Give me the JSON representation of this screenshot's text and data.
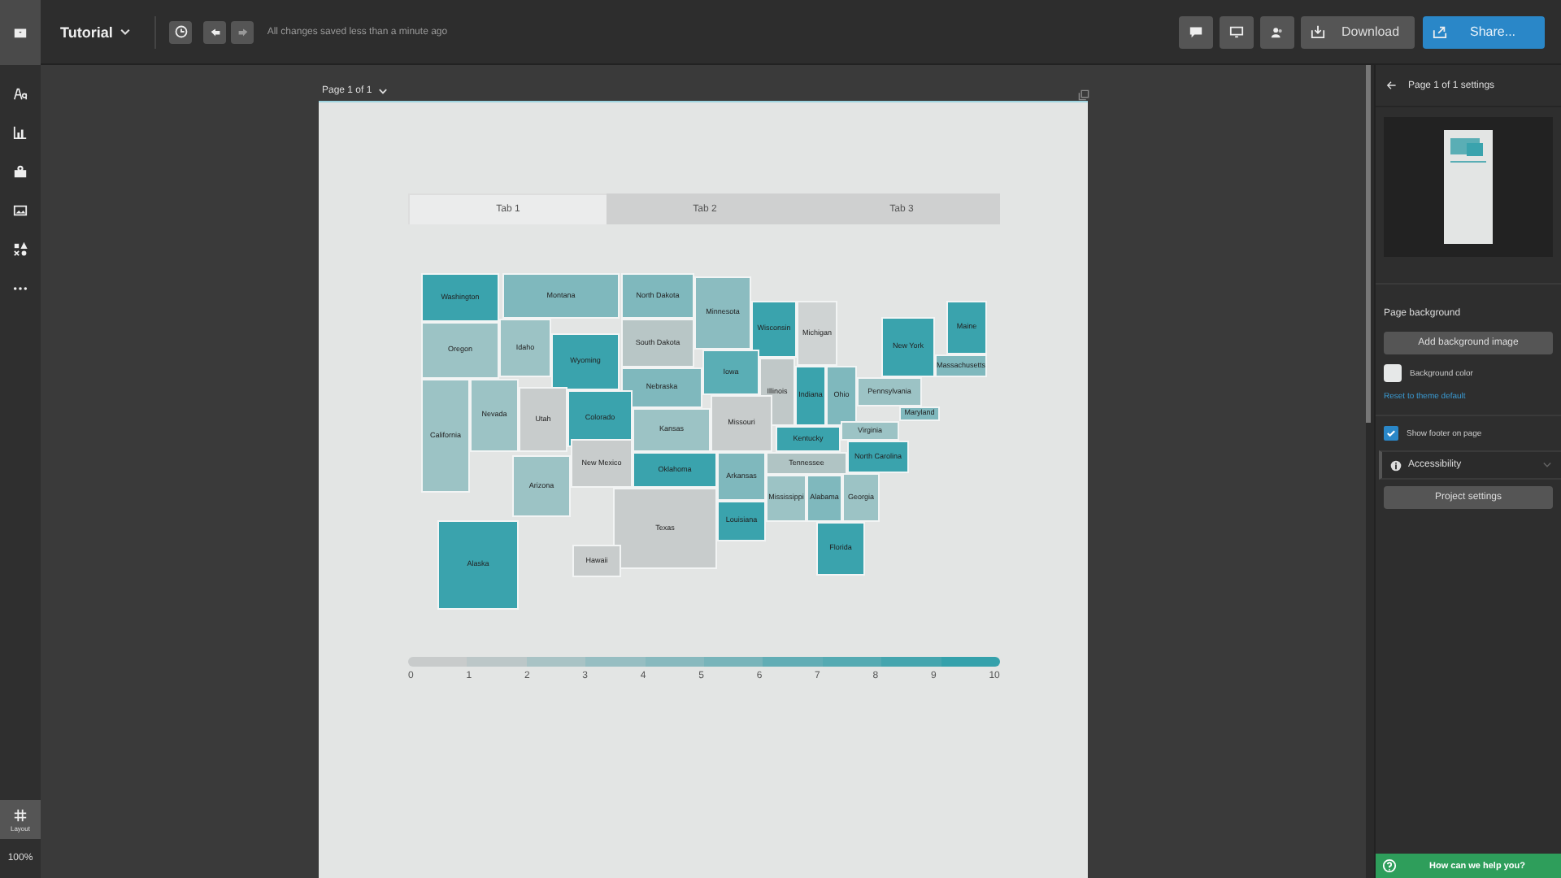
{
  "app_bar": {
    "title": "Tutorial",
    "status": "All changes saved less than a minute ago",
    "download": "Download",
    "share": "Share..."
  },
  "sidebar": {
    "layout": "Layout",
    "zoom": "100%"
  },
  "page": {
    "label": "Page 1 of 1",
    "tabs": [
      {
        "label": "Tab 1",
        "selected": true
      },
      {
        "label": "Tab 2",
        "selected": false
      },
      {
        "label": "Tab 3",
        "selected": false
      }
    ],
    "states": [
      {
        "name": "Washington",
        "color": "#3aa3ad"
      },
      {
        "name": "Montana",
        "color": "#7fb8bd"
      },
      {
        "name": "North Dakota",
        "color": "#7fb8bd"
      },
      {
        "name": "Minnesota",
        "color": "#8bbcc0"
      },
      {
        "name": "Wisconsin",
        "color": "#3aa3ad"
      },
      {
        "name": "Michigan",
        "color": "#cfd3d3"
      },
      {
        "name": "Maine",
        "color": "#3aa3ad"
      },
      {
        "name": "Idaho",
        "color": "#9cc3c5"
      },
      {
        "name": "South Dakota",
        "color": "#b8c6c6"
      },
      {
        "name": "New York",
        "color": "#3aa3ad"
      },
      {
        "name": "Oregon",
        "color": "#9cc3c5"
      },
      {
        "name": "Wyoming",
        "color": "#3aa3ad"
      },
      {
        "name": "Iowa",
        "color": "#5aaeb5"
      },
      {
        "name": "Massachusetts",
        "color": "#7fb8bd"
      },
      {
        "name": "Illinois",
        "color": "#c0c8c8"
      },
      {
        "name": "Indiana",
        "color": "#3aa3ad"
      },
      {
        "name": "Ohio",
        "color": "#7fb8bd"
      },
      {
        "name": "Nebraska",
        "color": "#7fb8bd"
      },
      {
        "name": "Pennsylvania",
        "color": "#9cc3c5"
      },
      {
        "name": "California",
        "color": "#9cc3c5"
      },
      {
        "name": "Nevada",
        "color": "#9cc3c5"
      },
      {
        "name": "Utah",
        "color": "#c8cccc"
      },
      {
        "name": "Colorado",
        "color": "#3aa3ad"
      },
      {
        "name": "Missouri",
        "color": "#c8cccc"
      },
      {
        "name": "Kansas",
        "color": "#9cc3c5"
      },
      {
        "name": "Maryland",
        "color": "#7fb8bd"
      },
      {
        "name": "Virginia",
        "color": "#9cc3c5"
      },
      {
        "name": "Kentucky",
        "color": "#3aa3ad"
      },
      {
        "name": "New Mexico",
        "color": "#c8cccc"
      },
      {
        "name": "North Carolina",
        "color": "#3aa3ad"
      },
      {
        "name": "Oklahoma",
        "color": "#3aa3ad"
      },
      {
        "name": "Arkansas",
        "color": "#7fb8bd"
      },
      {
        "name": "Tennessee",
        "color": "#b0c4c4"
      },
      {
        "name": "Arizona",
        "color": "#9cc3c5"
      },
      {
        "name": "Mississippi",
        "color": "#9cc3c5"
      },
      {
        "name": "Alabama",
        "color": "#7fb8bd"
      },
      {
        "name": "Georgia",
        "color": "#9cc3c5"
      },
      {
        "name": "Texas",
        "color": "#c8cccc"
      },
      {
        "name": "Louisiana",
        "color": "#3aa3ad"
      },
      {
        "name": "Alaska",
        "color": "#3aa3ad"
      },
      {
        "name": "Florida",
        "color": "#3aa3ad"
      },
      {
        "name": "Hawaii",
        "color": "#c8cccc"
      }
    ],
    "legend": {
      "segments": [
        {
          "color": "#c8cbcb"
        },
        {
          "color": "#bcc7c8"
        },
        {
          "color": "#a9c3c5"
        },
        {
          "color": "#97bec2"
        },
        {
          "color": "#88b9be"
        },
        {
          "color": "#78b4ba"
        },
        {
          "color": "#62adb5"
        },
        {
          "color": "#55aab2"
        },
        {
          "color": "#45a5ae"
        },
        {
          "color": "#35a1ab"
        }
      ],
      "ticks": [
        "0",
        "1",
        "2",
        "3",
        "4",
        "5",
        "6",
        "7",
        "8",
        "9",
        "10"
      ]
    }
  },
  "settings_panel": {
    "title": "Page 1 of 1 settings",
    "section": "Page background",
    "add_image": "Add background image",
    "background_color": "Background color",
    "reset_link": "Reset to theme default",
    "footer": {
      "label": "Show footer on page",
      "checked": true
    },
    "accessibility": {
      "label": "Accessibility",
      "expanded": false
    },
    "project_settings": "Project settings"
  },
  "help": "How can we help you?"
}
